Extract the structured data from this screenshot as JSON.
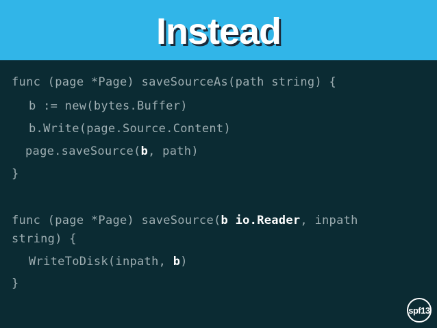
{
  "header": {
    "title": "Instead"
  },
  "code": {
    "l1": "func (page *Page) saveSourceAs(path string) {",
    "l2": "b := new(bytes.Buffer)",
    "l3": "b.Write(page.Source.Content)",
    "l4": {
      "pre": "page.saveSource(",
      "bold": "b",
      "post": ", path)"
    },
    "l5": "}",
    "l6": {
      "pre": "func (page *Page) saveSource(",
      "bold": "b io.Reader",
      "post": ", inpath"
    },
    "l7": "string) {",
    "l8": {
      "pre": "WriteToDisk(inpath, ",
      "bold": "b",
      "post": ")"
    },
    "l9": "}"
  },
  "badge": {
    "label": "spf13"
  }
}
